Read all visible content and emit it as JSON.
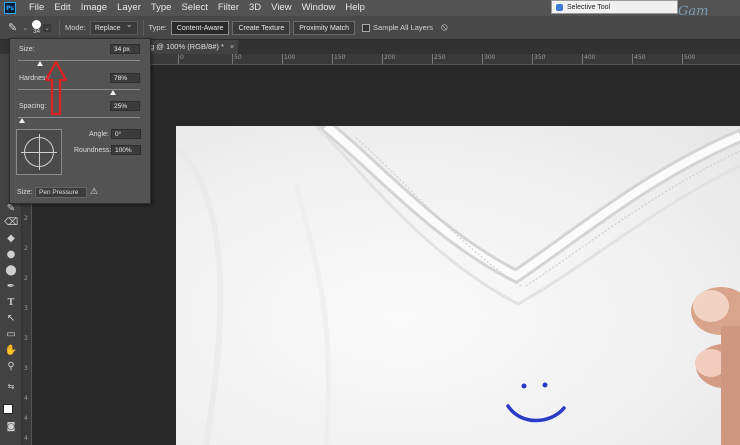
{
  "menubar": {
    "logo": "Ps",
    "items": [
      "File",
      "Edit",
      "Image",
      "Layer",
      "Type",
      "Select",
      "Filter",
      "3D",
      "View",
      "Window",
      "Help"
    ]
  },
  "optionsbar": {
    "brush_size": "34",
    "mode_label": "Mode:",
    "mode_value": "Replace",
    "type_label": "Type:",
    "type_buttons": [
      "Content-Aware",
      "Create Texture",
      "Proximity Match"
    ],
    "sample_all_layers": "Sample All Layers"
  },
  "selective_tool": {
    "title": "Selective Tool"
  },
  "watermark": "Gam",
  "document_tab": {
    "title": "g @ 100% (RGB/8#) *",
    "close": "×"
  },
  "ruler": {
    "top_ticks": [
      "0",
      "50",
      "100",
      "150",
      "200",
      "250",
      "300",
      "350",
      "400",
      "450",
      "500"
    ],
    "left_ticks": [
      "2",
      "2",
      "2",
      "3",
      "3",
      "3",
      "4",
      "4",
      "4"
    ]
  },
  "brush_panel": {
    "size_label": "Size:",
    "size_value": "34 px",
    "size_fraction": 0.18,
    "hardness_label": "Hardness:",
    "hardness_value": "78%",
    "hardness_fraction": 0.78,
    "spacing_label": "Spacing:",
    "spacing_value": "25%",
    "spacing_fraction": 0.03,
    "angle_label": "Angle:",
    "angle_value": "0°",
    "roundness_label": "Roundness:",
    "roundness_value": "100%",
    "pen_size_label": "Size:",
    "pen_size_control": "Pen Pressure",
    "warning": "⚠"
  },
  "tools": [
    "⌫",
    "◆",
    "⚗",
    "✋",
    "●",
    "✎",
    "T",
    "↖",
    "▭",
    "✋",
    "🔍"
  ],
  "colors": {
    "arrow": "#e02020",
    "accent": "#31a8ff"
  }
}
